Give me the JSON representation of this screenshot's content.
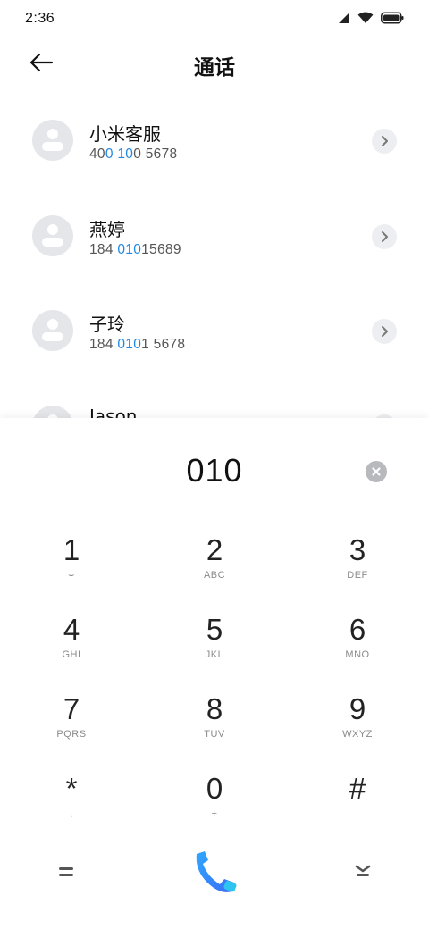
{
  "status_bar": {
    "time": "2:36",
    "icons": [
      "signal-icon",
      "wifi-icon",
      "battery-icon"
    ]
  },
  "app_bar": {
    "title": "通话",
    "back_icon": "arrow-left-icon"
  },
  "contacts": [
    {
      "name": "小米客服",
      "number_parts": [
        {
          "text": "40",
          "highlight": false
        },
        {
          "text": "0",
          "highlight": true
        },
        {
          "text": " ",
          "highlight": false
        },
        {
          "text": "10",
          "highlight": true
        },
        {
          "text": "0 5678",
          "highlight": false
        }
      ]
    },
    {
      "name": "燕婷",
      "number_parts": [
        {
          "text": "184 ",
          "highlight": false
        },
        {
          "text": "010",
          "highlight": true
        },
        {
          "text": "15689",
          "highlight": false
        }
      ]
    },
    {
      "name": "子玲",
      "number_parts": [
        {
          "text": "184 ",
          "highlight": false
        },
        {
          "text": "010",
          "highlight": true
        },
        {
          "text": "1 5678",
          "highlight": false
        }
      ]
    },
    {
      "name": "Jason",
      "number_parts": []
    }
  ],
  "dialer": {
    "typed_number": "010",
    "clear_icon": "clear-icon",
    "keys": [
      {
        "digit": "1",
        "letters": "⌣"
      },
      {
        "digit": "2",
        "letters": "ABC"
      },
      {
        "digit": "3",
        "letters": "DEF"
      },
      {
        "digit": "4",
        "letters": "GHI"
      },
      {
        "digit": "5",
        "letters": "JKL"
      },
      {
        "digit": "6",
        "letters": "MNO"
      },
      {
        "digit": "7",
        "letters": "PQRS"
      },
      {
        "digit": "8",
        "letters": "TUV"
      },
      {
        "digit": "9",
        "letters": "WXYZ"
      },
      {
        "digit": "*",
        "letters": ","
      },
      {
        "digit": "0",
        "letters": "+"
      },
      {
        "digit": "#",
        "letters": ""
      }
    ]
  },
  "bottom_bar": {
    "menu_icon": "menu-icon",
    "call_icon": "phone-icon",
    "hide_icon": "chevron-down-icon"
  },
  "colors": {
    "highlight": "#1e88e5",
    "call_gradient_start": "#2fa8ff",
    "call_gradient_end": "#3a6cf6"
  }
}
